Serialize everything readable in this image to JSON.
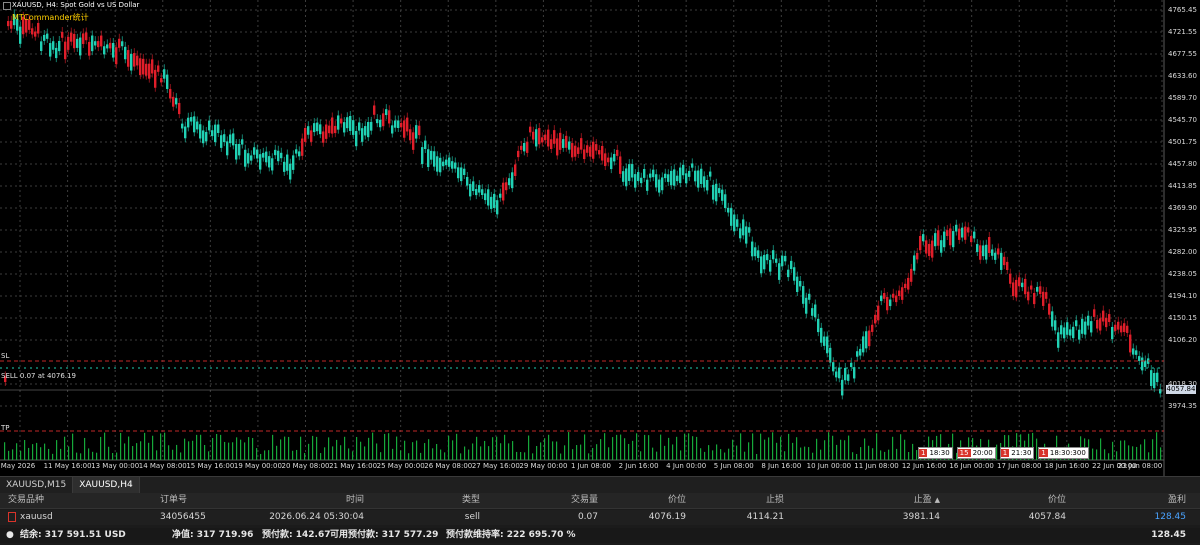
{
  "chart": {
    "title": "XAUUSD, H4:  Spot Gold vs US Dollar",
    "indicator": "MTCommander统计",
    "y_ticks": [
      "4765.45",
      "4721.55",
      "4677.55",
      "4633.60",
      "4589.70",
      "4545.70",
      "4501.75",
      "4457.80",
      "4413.85",
      "4369.90",
      "4325.95",
      "4282.00",
      "4238.05",
      "4194.10",
      "4150.15",
      "4106.20",
      "4018.30",
      "3974.35"
    ],
    "x_ticks": [
      "May 2026",
      "11 May 16:00",
      "13 May 00:00",
      "14 May 08:00",
      "15 May 16:00",
      "19 May 00:00",
      "20 May 08:00",
      "21 May 16:00",
      "25 May 00:00",
      "26 May 08:00",
      "27 May 16:00",
      "29 May 00:00",
      "1 Jun 08:00",
      "2 Jun 16:00",
      "4 Jun 00:00",
      "5 Jun 08:00",
      "8 Jun 16:00",
      "10 Jun 00:00",
      "11 Jun 08:00",
      "12 Jun 16:00",
      "16 Jun 00:00",
      "17 Jun 08:00",
      "18 Jun 16:00",
      "22 Jun 00:00",
      "23 Jun 08:00"
    ],
    "current_price": "4057.84",
    "sell_line_label": "SELL 0.07 at 4076.19",
    "sl_label": "SL",
    "tp_label": "TP",
    "time_chips": [
      {
        "n": "1",
        "t": "18:30"
      },
      {
        "n": "15",
        "t": "20:00"
      },
      {
        "n": "1",
        "t": "21:30"
      },
      {
        "n": "1",
        "t": "18:30:300"
      }
    ],
    "colors": {
      "bull": "#21d1b4",
      "bear": "#e01e2a",
      "grid": "#3c3c3c",
      "sl_line": "#c02828",
      "volume": "#16a83a"
    }
  },
  "tabs": [
    {
      "label": "XAUUSD,M15"
    },
    {
      "label": "XAUUSD,H4"
    }
  ],
  "positions": {
    "headers": {
      "symbol": "交易品种",
      "order": "订单号",
      "time": "时间",
      "type": "类型",
      "volume": "交易量",
      "price": "价位",
      "sl": "止损",
      "tp": "止盈",
      "current_price": "价位",
      "profit": "盈利"
    },
    "row": {
      "symbol": "xauusd",
      "order": "34056455",
      "time": "2026.06.24 05:30:04",
      "type": "sell",
      "volume": "0.07",
      "price": "4076.19",
      "sl": "4114.21",
      "tp": "3981.14",
      "current_price": "4057.84",
      "profit": "128.45"
    },
    "summary": {
      "balance": "结余: 317 591.51 USD",
      "equity": "净值: 317 719.96",
      "margin": "预付款: 142.67",
      "free_margin": "可用预付款: 317 577.29",
      "margin_level": "预付款维持率: 222 695.70 %",
      "total_profit": "128.45"
    }
  }
}
